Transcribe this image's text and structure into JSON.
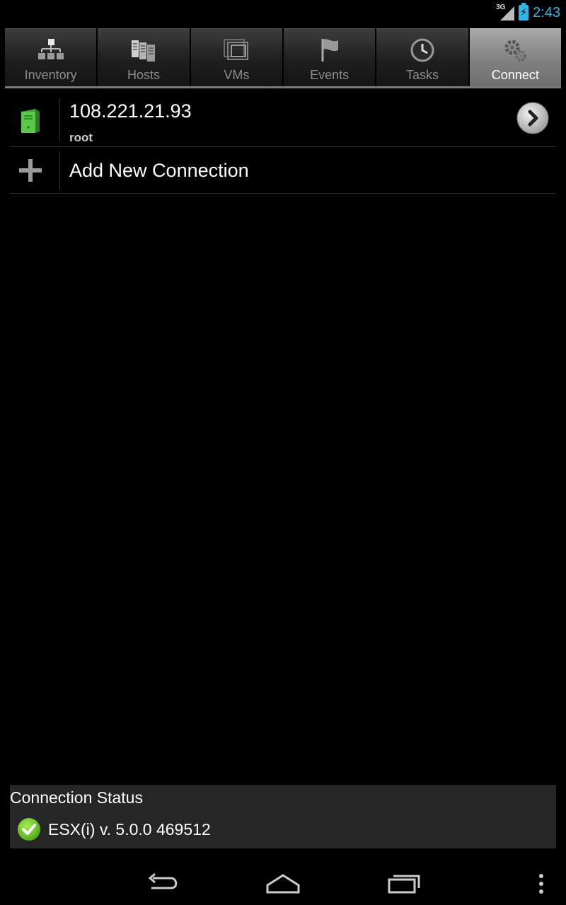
{
  "status_bar": {
    "network": "3G",
    "time": "2:43"
  },
  "tabs": [
    {
      "label": "Inventory",
      "icon": "inventory-icon",
      "active": false
    },
    {
      "label": "Hosts",
      "icon": "hosts-icon",
      "active": false
    },
    {
      "label": "VMs",
      "icon": "vms-icon",
      "active": false
    },
    {
      "label": "Events",
      "icon": "flag-icon",
      "active": false
    },
    {
      "label": "Tasks",
      "icon": "clock-icon",
      "active": false
    },
    {
      "label": "Connect",
      "icon": "gears-icon",
      "active": true
    }
  ],
  "connections": [
    {
      "host": "108.221.21.93",
      "user": "root",
      "icon": "green-server-icon"
    }
  ],
  "add_connection": {
    "label": "Add New Connection",
    "icon": "plus-icon"
  },
  "connection_status": {
    "title": "Connection Status",
    "text": "ESX(i) v. 5.0.0 469512",
    "icon": "green-check-icon"
  },
  "navigation": {
    "buttons": [
      "back-icon",
      "home-icon",
      "recent-apps-icon",
      "overflow-menu-icon"
    ]
  },
  "colors": {
    "accent": "#33b5e5",
    "active_tab": "#8a8a8a",
    "ok_green": "#7bd12a"
  }
}
